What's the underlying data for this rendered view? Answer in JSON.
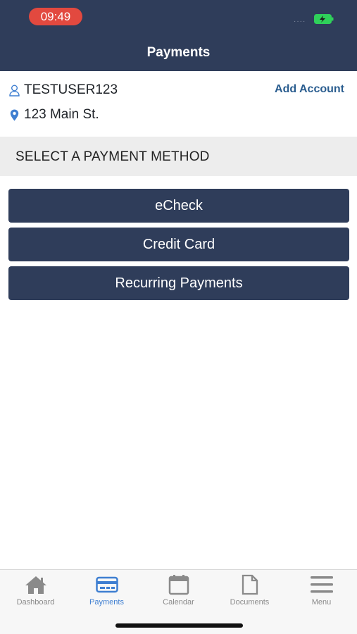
{
  "status_bar": {
    "time": "09:49",
    "signal": "····"
  },
  "header": {
    "title": "Payments"
  },
  "account": {
    "username": "TESTUSER123",
    "address": "123 Main St.",
    "add_account_label": "Add Account"
  },
  "section": {
    "title": "SELECT A PAYMENT METHOD"
  },
  "methods": [
    {
      "label": "eCheck"
    },
    {
      "label": "Credit Card"
    },
    {
      "label": "Recurring Payments"
    }
  ],
  "tabbar": {
    "items": [
      {
        "label": "Dashboard",
        "icon": "home-icon"
      },
      {
        "label": "Payments",
        "icon": "credit-card-icon",
        "active": true
      },
      {
        "label": "Calendar",
        "icon": "calendar-icon"
      },
      {
        "label": "Documents",
        "icon": "document-icon"
      },
      {
        "label": "Menu",
        "icon": "menu-icon"
      }
    ]
  },
  "colors": {
    "header_bg": "#2f3d5a",
    "button_bg": "#2f3d5a",
    "accent": "#3f7fd1",
    "link": "#2a5d8f",
    "time_pill": "#e2493f"
  }
}
